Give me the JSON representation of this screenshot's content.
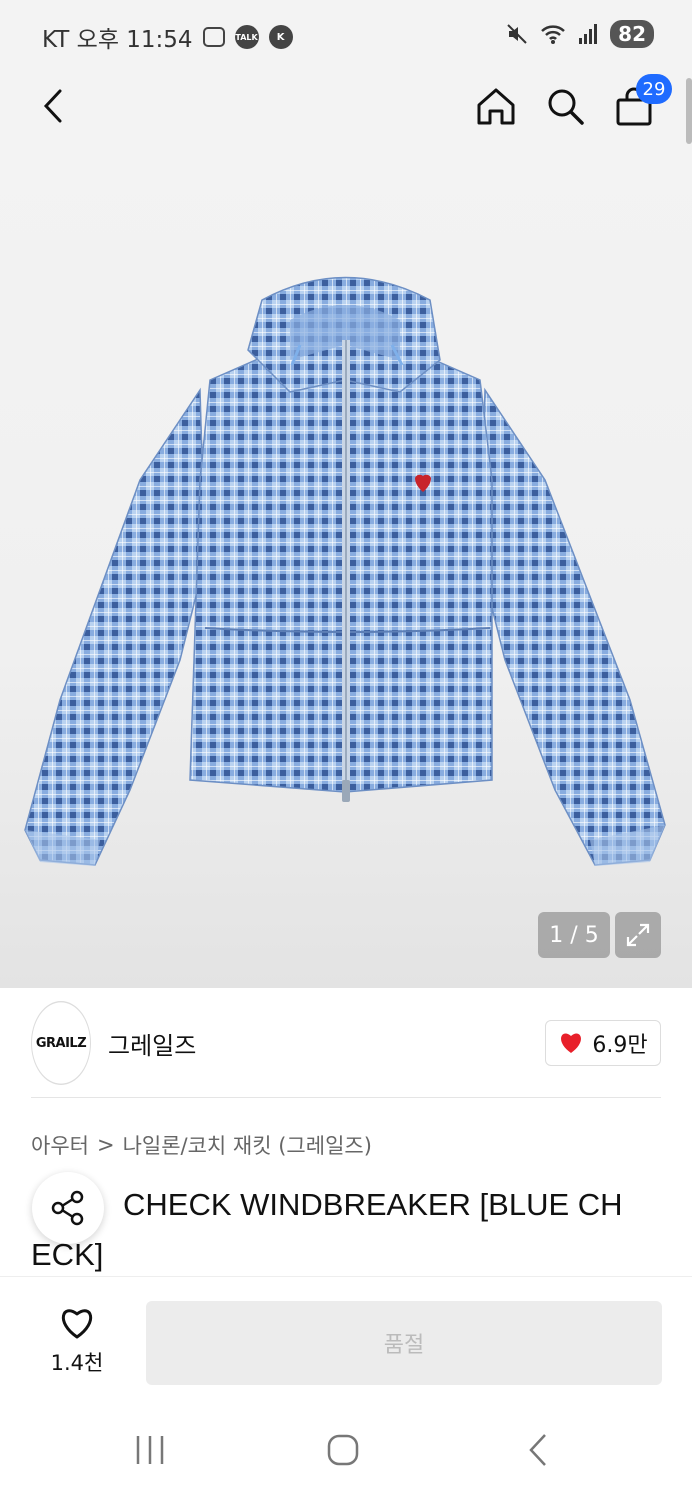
{
  "status_bar": {
    "carrier_time": "KT 오후 11:54",
    "talk_icon_text": "TALK",
    "k_icon_text": "K",
    "battery": "82"
  },
  "header": {
    "cart_count": "29"
  },
  "gallery": {
    "counter": "1 / 5"
  },
  "brand": {
    "logo_text": "GRAILZ",
    "name": "그레일즈",
    "likes": "6.9만"
  },
  "breadcrumb": {
    "category": "아우터",
    "separator": ">",
    "subcategory": "나일론/코치 재킷 (그레일즈)"
  },
  "product": {
    "title": "CHECK WINDBREAKER [BLUE CH ECK]",
    "title_prefix_hidden": "E"
  },
  "actions": {
    "wish_count": "1.4천",
    "soldout_label": "품절"
  },
  "colors": {
    "accent": "#1f6bff",
    "heart": "#e8202a",
    "jacket": "#8fb6e6"
  }
}
